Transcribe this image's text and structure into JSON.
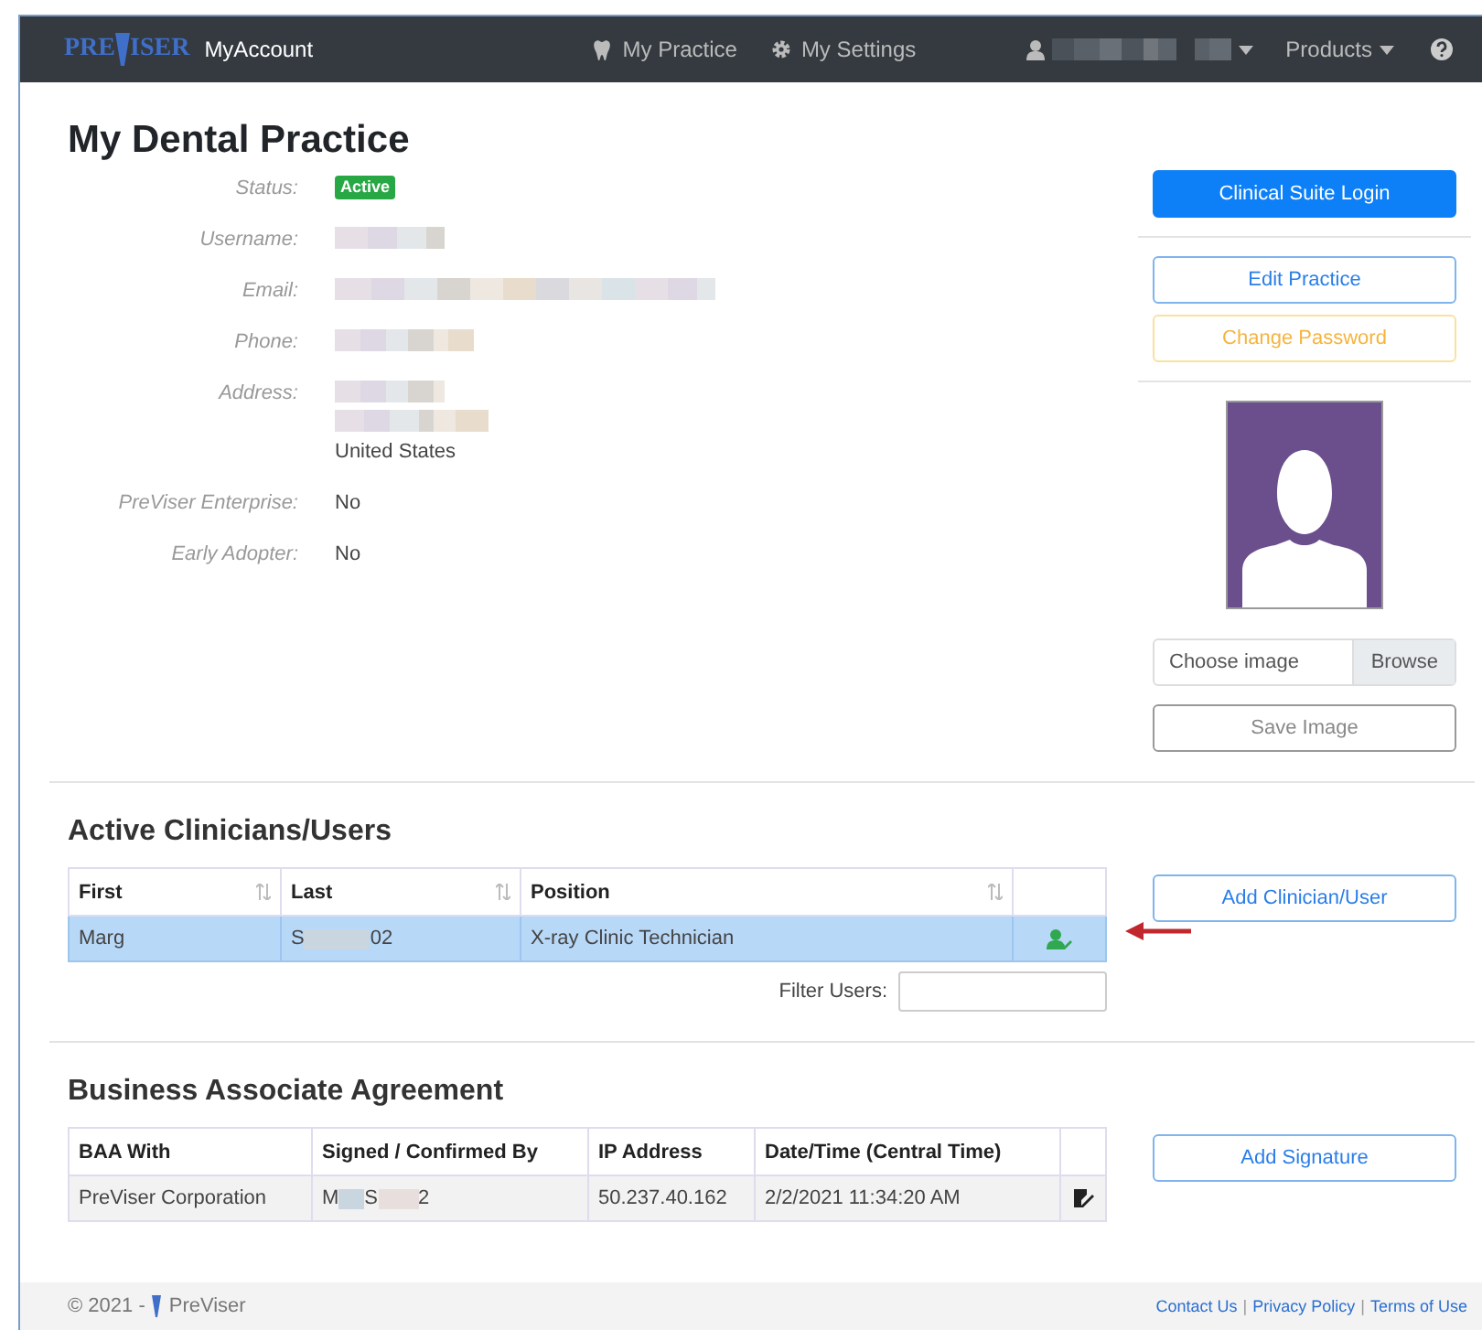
{
  "navbar": {
    "brand": {
      "left": "PRE",
      "right": "ISER"
    },
    "app_name": "MyAccount",
    "links": [
      {
        "label": "My Practice"
      },
      {
        "label": "My Settings"
      }
    ],
    "products": "Products"
  },
  "practice": {
    "title": "My Dental Practice",
    "fields": [
      {
        "label": "Status:",
        "kind": "badge",
        "value": "Active"
      },
      {
        "label": "Username:",
        "kind": "redacted"
      },
      {
        "label": "Email:",
        "kind": "redacted"
      },
      {
        "label": "Phone:",
        "kind": "redacted"
      },
      {
        "label": "Address:",
        "kind": "redacted",
        "value": "United States"
      },
      {
        "label": "PreViser Enterprise:",
        "kind": "text",
        "value": "No"
      },
      {
        "label": "Early Adopter:",
        "kind": "text",
        "value": "No"
      }
    ]
  },
  "side": {
    "login": "Clinical Suite Login",
    "edit": "Edit Practice",
    "password": "Change Password",
    "file_placeholder": "Choose image",
    "browse": "Browse",
    "save": "Save Image"
  },
  "clinicians": {
    "title": "Active Clinicians/Users",
    "columns": [
      "First",
      "Last",
      "Position"
    ],
    "rows": [
      {
        "first": "Marg",
        "last": [
          "S",
          "02"
        ],
        "position": "X-ray Clinic Technician",
        "selected": true
      }
    ],
    "filter_label": "Filter Users:",
    "add": "Add Clinician/User"
  },
  "baa": {
    "title": "Business Associate Agreement",
    "columns": [
      "BAA With",
      "Signed / Confirmed By",
      "IP Address",
      "Date/Time (Central Time)"
    ],
    "rows": [
      {
        "with": "PreViser Corporation",
        "signed": [
          "M",
          "S",
          "2"
        ],
        "ip": "50.237.40.162",
        "date": "2/2/2021 11:34:20 AM"
      }
    ],
    "add": "Add Signature"
  },
  "footer": {
    "copyright": "© 2021 -",
    "brand": "PreViser",
    "links": [
      "Contact Us",
      "Privacy Policy",
      "Terms of Use"
    ],
    "separator": "|"
  }
}
